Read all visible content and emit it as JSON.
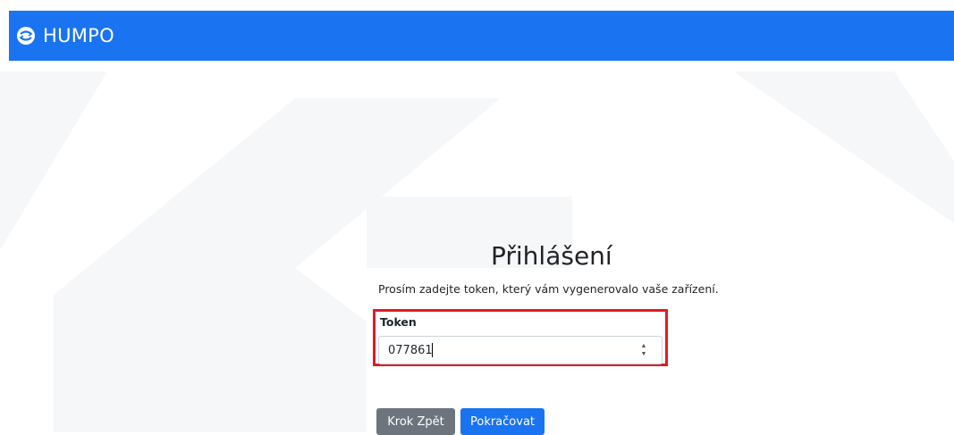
{
  "navbar": {
    "brand_text": "HUMPO",
    "brand_icon": "humpo-logo-icon",
    "color": "#1a73f0"
  },
  "login": {
    "title": "Přihlášení",
    "subtitle": "Prosím zadejte token, který vám vygenerovalo vaše zařízení.",
    "token_label": "Token",
    "token_value": "077861",
    "back_button": "Krok Zpět",
    "continue_button": "Pokračovat"
  },
  "colors": {
    "primary": "#1a73f0",
    "secondary": "#6c757d",
    "highlight": "#e01b24"
  }
}
